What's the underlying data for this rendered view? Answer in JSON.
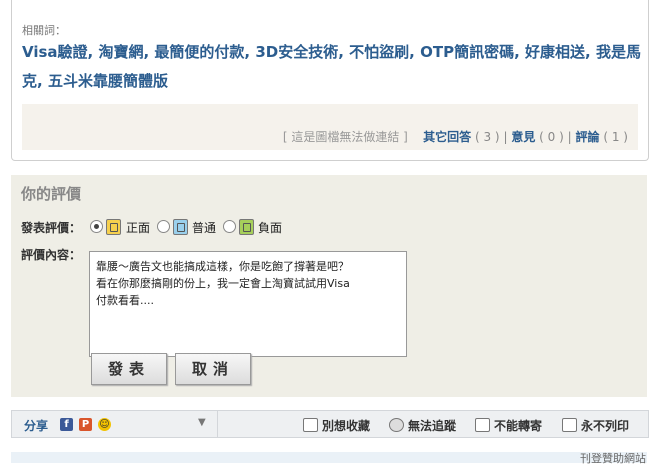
{
  "related": {
    "label": "相關詞：",
    "links": [
      "Visa驗證",
      "淘寶網",
      "最簡便的付款",
      "3D安全技術",
      "不怕盜刷",
      "OTP簡訊密碼",
      "好康相送",
      "我是馬克",
      "五斗米靠腰簡體版"
    ],
    "separator": ", "
  },
  "card_footer": {
    "no_link_note": "[ 這是圖檔無法做連結 ]",
    "other_replies": {
      "label": "其它回答",
      "count": "( 3 )"
    },
    "opinions": {
      "label": "意見",
      "count": "( 0 )"
    },
    "comments": {
      "label": "評論",
      "count": "( 1 )"
    },
    "divider": "|"
  },
  "rating_form": {
    "title": "你的評價",
    "rate_label": "發表評價：",
    "options": [
      {
        "label": "正面",
        "selected": true,
        "icon": "positive-note-icon"
      },
      {
        "label": "普通",
        "selected": false,
        "icon": "neutral-note-icon"
      },
      {
        "label": "負面",
        "selected": false,
        "icon": "negative-note-icon"
      }
    ],
    "content_label": "評價內容：",
    "content_value": "靠腰～廣告文也能搞成這樣，你是吃飽了撐著是吧？\n看在你那麼搞剛的份上，我一定會上淘寶試試用Visa\n付款看看....",
    "submit_label": "發表",
    "cancel_label": "取消"
  },
  "share_bar": {
    "label": "分享",
    "tools": [
      {
        "label": "別想收藏",
        "icon": "bookmark-icon"
      },
      {
        "label": "無法追蹤",
        "icon": "track-icon"
      },
      {
        "label": "不能轉寄",
        "icon": "mail-icon"
      },
      {
        "label": "永不列印",
        "icon": "printer-icon"
      }
    ]
  },
  "bottom_text": "刊登贊助網站",
  "colors": {
    "link": "#2c5d8f",
    "panel_bg": "#efeee6",
    "footer_bg": "#f5f2ec"
  }
}
